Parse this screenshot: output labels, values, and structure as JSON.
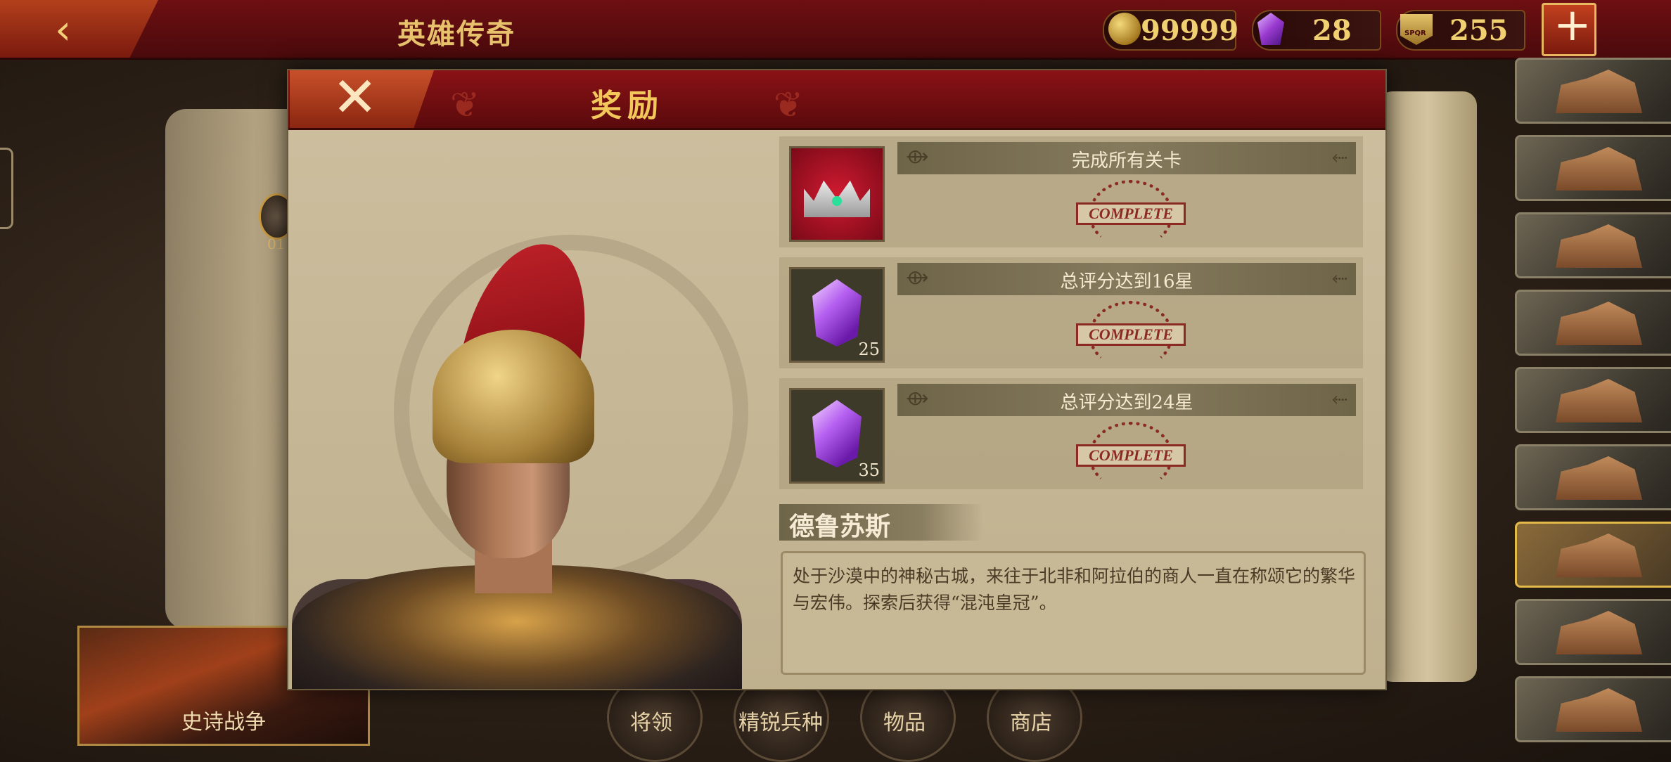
{
  "header": {
    "title": "英雄传奇",
    "back_icon": "back-arrow-icon",
    "resources": [
      {
        "name": "gold",
        "icon": "gold-coin-icon",
        "value": "99999"
      },
      {
        "name": "gem",
        "icon": "purple-gem-icon",
        "value": "28"
      },
      {
        "name": "spqr",
        "icon": "spqr-emblem-icon",
        "icon_text": "SPQR",
        "value": "255"
      }
    ],
    "add_label": "+"
  },
  "map": {
    "marker_label": "01"
  },
  "bottom_nav": {
    "epic_war": "史诗战争",
    "items": [
      "将领",
      "精锐兵种",
      "物品",
      "商店"
    ]
  },
  "dialog": {
    "title": "奖励",
    "close_label": "✕",
    "rewards": [
      {
        "item_icon": "chaos-crown-icon",
        "quantity": "",
        "requirement": "完成所有关卡",
        "status": "COMPLETE"
      },
      {
        "item_icon": "purple-gem-icon",
        "quantity": "25",
        "requirement": "总评分达到16星",
        "status": "COMPLETE"
      },
      {
        "item_icon": "purple-gem-icon",
        "quantity": "35",
        "requirement": "总评分达到24星",
        "status": "COMPLETE"
      }
    ],
    "hero_name": "德鲁苏斯",
    "description": "处于沙漠中的神秘古城，来往于北非和阿拉伯的商人一直在称颂它的繁华与宏伟。探索后获得“混沌皇冠”。"
  },
  "colors": {
    "banner_red": "#6e0f12",
    "gold_text": "#e7c16b",
    "complete_red": "#8a2a22"
  }
}
